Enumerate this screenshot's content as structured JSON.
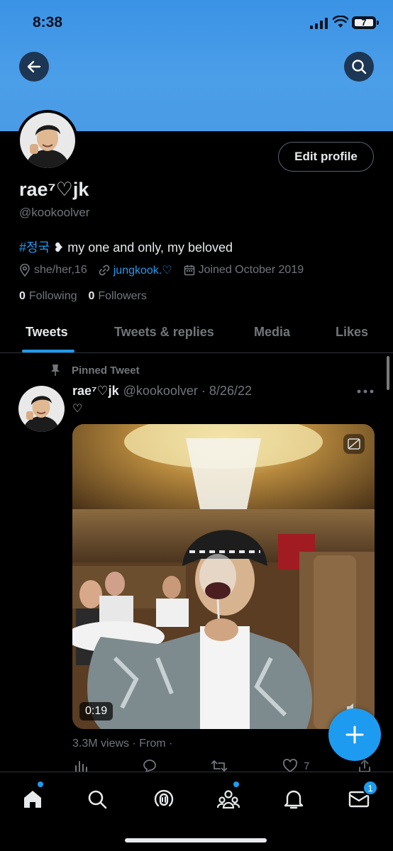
{
  "status_bar": {
    "time": "8:38",
    "battery_level": "7"
  },
  "profile": {
    "display_name": "rae⁷♡jk",
    "handle": "@kookoolver",
    "bio_hashtag": "#정국",
    "bio_text": " ❥ my one and only, my beloved",
    "location": "she/her,16",
    "link": "jungkook.♡",
    "joined": "Joined October 2019",
    "following_count": "0",
    "following_label": "Following",
    "followers_count": "0",
    "followers_label": "Followers",
    "edit_label": "Edit profile"
  },
  "tabs": [
    {
      "label": "Tweets",
      "active": true
    },
    {
      "label": "Tweets & replies",
      "active": false
    },
    {
      "label": "Media",
      "active": false
    },
    {
      "label": "Likes",
      "active": false
    }
  ],
  "tweet": {
    "pinned_label": "Pinned Tweet",
    "author_name": "rae⁷♡jk",
    "author_handle_date": "@kookoolver · 8/26/22",
    "text": "♡",
    "video_duration": "0:19",
    "views_line": "3.3M views · From ·",
    "like_count": "7"
  },
  "nav": {
    "messages_badge": "1"
  },
  "colors": {
    "accent": "#1d9bf0",
    "banner": "#4a9be6",
    "background": "#000000"
  },
  "icons": [
    "back-arrow-icon",
    "search-icon",
    "location-icon",
    "link-icon",
    "calendar-icon",
    "pin-icon",
    "more-icon",
    "captions-icon",
    "mute-icon",
    "stats-icon",
    "reply-icon",
    "retweet-icon",
    "like-icon",
    "share-icon",
    "compose-icon",
    "home-icon",
    "spaces-icon",
    "communities-icon",
    "bell-icon",
    "mail-icon"
  ]
}
